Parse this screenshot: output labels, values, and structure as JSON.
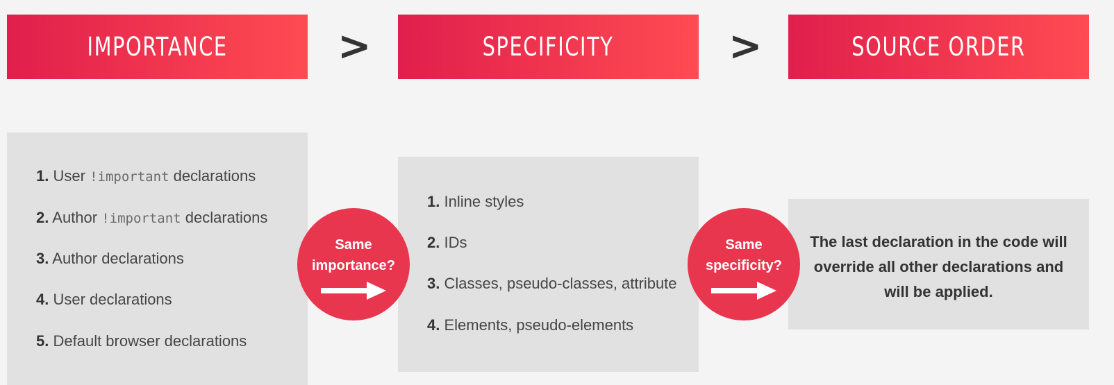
{
  "headers": [
    "IMPORTANCE",
    "SPECIFICITY",
    "SOURCE ORDER"
  ],
  "separator": ">",
  "importance": {
    "items": [
      {
        "num": "1.",
        "before": "User",
        "code": "!important",
        "after": "declarations"
      },
      {
        "num": "2.",
        "before": "Author",
        "code": "!important",
        "after": "declarations"
      },
      {
        "num": "3.",
        "before": "Author declarations",
        "code": "",
        "after": ""
      },
      {
        "num": "4.",
        "before": "User declarations",
        "code": "",
        "after": ""
      },
      {
        "num": "5.",
        "before": "Default browser declarations",
        "code": "",
        "after": ""
      }
    ]
  },
  "specificity": {
    "items": [
      {
        "num": "1.",
        "text": "Inline styles"
      },
      {
        "num": "2.",
        "text": "IDs"
      },
      {
        "num": "3.",
        "text": "Classes, pseudo-classes, attribute"
      },
      {
        "num": "4.",
        "text": "Elements, pseudo-elements"
      }
    ]
  },
  "source_order": {
    "lines": [
      "The last declaration in the code will",
      "override all other declarations and",
      "will be applied."
    ]
  },
  "circles": [
    {
      "line1": "Same",
      "line2": "importance?",
      "icon": "arrow-right-icon"
    },
    {
      "line1": "Same",
      "line2": "specificity?",
      "icon": "arrow-right-icon"
    }
  ],
  "colors": {
    "gradient_start": "#e01f4c",
    "gradient_end": "#ff4b52",
    "circle": "#e8364f",
    "panel": "#e1e1e1",
    "background": "#f4f4f4"
  }
}
